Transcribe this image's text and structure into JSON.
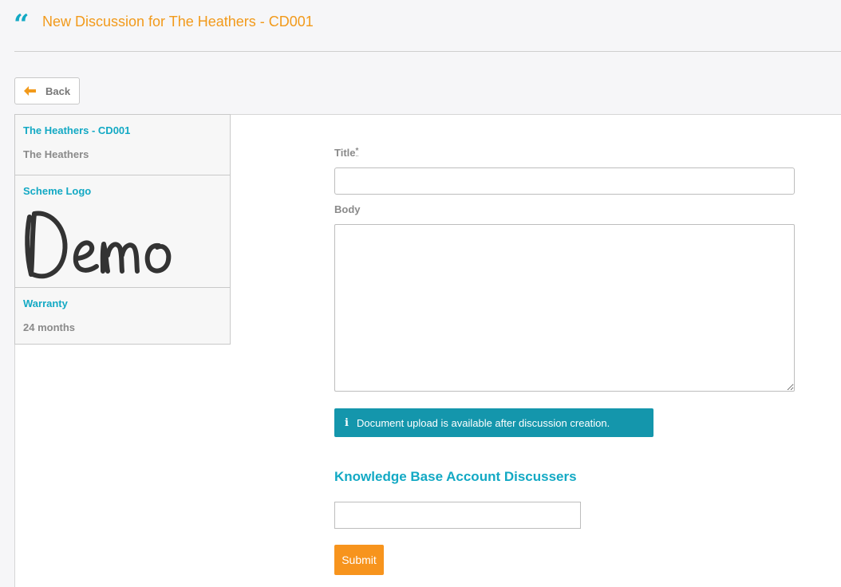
{
  "header": {
    "icon": "quote-icon",
    "title": "New Discussion for The Heathers - CD001"
  },
  "back_button": {
    "icon": "arrow-left-icon",
    "label": "Back"
  },
  "info_panel": {
    "scheme": {
      "heading": "The Heathers - CD001",
      "value": "The Heathers"
    },
    "logo": {
      "heading": "Scheme Logo",
      "image_text": "Demo"
    },
    "warranty": {
      "heading": "Warranty",
      "value": "24 months"
    }
  },
  "form": {
    "title_label": "Title",
    "title_required_marker": "*",
    "title_value": "",
    "body_label": "Body",
    "body_value": "",
    "info_message": "Document upload is available after discussion creation.",
    "info_icon": "info-icon",
    "kb_heading": "Knowledge Base Account Discussers",
    "kb_value": "",
    "submit_label": "Submit"
  },
  "colors": {
    "accent_orange": "#f29a1b",
    "accent_teal": "#13a9c4",
    "alert_bg": "#1496ac",
    "submit_bg": "#f7941d"
  }
}
